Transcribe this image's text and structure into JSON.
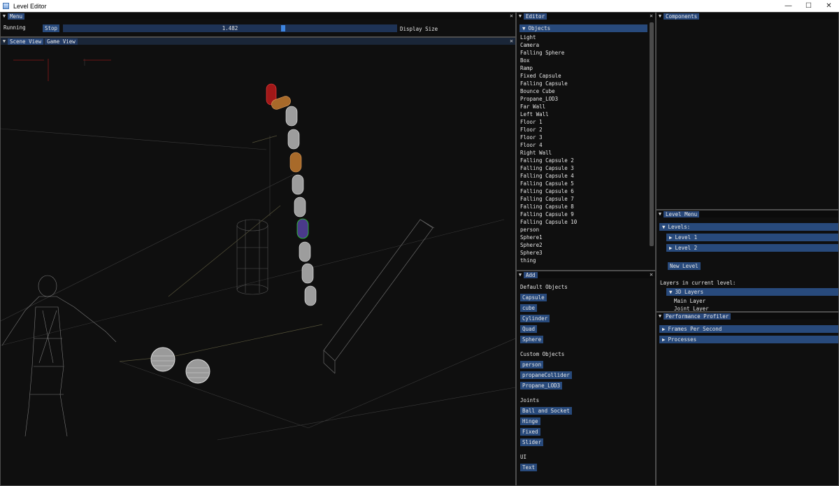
{
  "window": {
    "title": "Level Editor",
    "minimize": "—",
    "maximize": "☐",
    "close": "✕"
  },
  "menu": {
    "tab": "Menu",
    "status": "Running",
    "stop_button": "Stop",
    "slider_value": "1.482",
    "slider_label": "Display Size",
    "slider_fraction": 0.66
  },
  "scene": {
    "tab_scene": "Scene View",
    "tab_game": "Game View"
  },
  "editor": {
    "tab": "Editor",
    "objects_header": "Objects",
    "objects": [
      "Light",
      "Camera",
      "Falling Sphere",
      "Box",
      "Ramp",
      "Fixed Capsule",
      "Falling Capsule",
      "Bounce Cube",
      "Propane_LOD3",
      "Far Wall",
      "Left Wall",
      "Floor 1",
      "Floor 2",
      "Floor 3",
      "Floor 4",
      "Right Wall",
      "Falling Capsule 2",
      "Falling Capsule 3",
      "Falling Capsule 4",
      "Falling Capsule 5",
      "Falling Capsule 6",
      "Falling Capsule 7",
      "Falling Capsule 8",
      "Falling Capsule 9",
      "Falling Capsule 10",
      "person",
      "Sphere1",
      "Sphere2",
      "Sphere3",
      "thing"
    ]
  },
  "add": {
    "tab": "Add",
    "default_label": "Default Objects",
    "default_items": [
      "Capsule",
      "cube",
      "Cylinder",
      "Quad",
      "Sphere"
    ],
    "custom_label": "Custom Objects",
    "custom_items": [
      "person",
      "propaneCollider",
      "Propane_LOD3"
    ],
    "joints_label": "Joints",
    "joint_items": [
      "Ball and Socket",
      "Hinge",
      "Fixed",
      "Slider"
    ],
    "ui_label": "UI",
    "ui_items": [
      "Text"
    ]
  },
  "components": {
    "tab": "Components"
  },
  "level_menu": {
    "tab": "Level Menu",
    "levels_header": "Levels:",
    "levels": [
      "Level 1",
      "Level 2"
    ],
    "new_level_button": "New Level",
    "layers_label": "Layers in current level:",
    "layers_header": "3D Layers",
    "layers": [
      "Main Layer",
      "Joint Layer"
    ]
  },
  "profiler": {
    "tab": "Performance Profiler",
    "sections": [
      "Frames Per Second",
      "Processes"
    ]
  }
}
